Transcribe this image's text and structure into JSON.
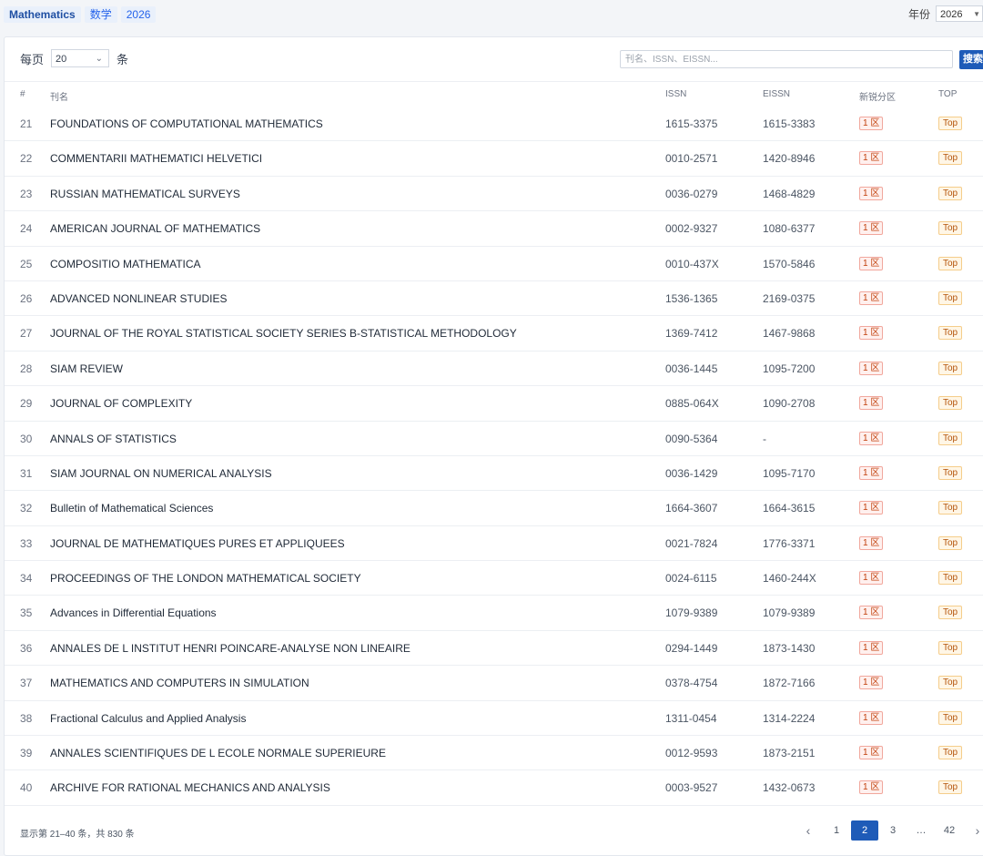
{
  "tags": [
    "Mathematics",
    "数学",
    "2026"
  ],
  "year": {
    "label": "年份",
    "value": "2026"
  },
  "controls": {
    "perpage_label": "每页",
    "perpage_value": "20",
    "perpage_unit": "条",
    "search_placeholder": "刊名、ISSN、EISSN...",
    "search_button": "搜索"
  },
  "columns": {
    "num": "#",
    "name": "刊名",
    "issn": "ISSN",
    "eissn": "EISSN",
    "zone": "新锐分区",
    "top": "TOP"
  },
  "rows": [
    {
      "num": "21",
      "name": "FOUNDATIONS OF COMPUTATIONAL MATHEMATICS",
      "issn": "1615-3375",
      "eissn": "1615-3383",
      "zone": "1 区",
      "top": "Top"
    },
    {
      "num": "22",
      "name": "COMMENTARII MATHEMATICI HELVETICI",
      "issn": "0010-2571",
      "eissn": "1420-8946",
      "zone": "1 区",
      "top": "Top"
    },
    {
      "num": "23",
      "name": "RUSSIAN MATHEMATICAL SURVEYS",
      "issn": "0036-0279",
      "eissn": "1468-4829",
      "zone": "1 区",
      "top": "Top"
    },
    {
      "num": "24",
      "name": "AMERICAN JOURNAL OF MATHEMATICS",
      "issn": "0002-9327",
      "eissn": "1080-6377",
      "zone": "1 区",
      "top": "Top"
    },
    {
      "num": "25",
      "name": "COMPOSITIO MATHEMATICA",
      "issn": "0010-437X",
      "eissn": "1570-5846",
      "zone": "1 区",
      "top": "Top"
    },
    {
      "num": "26",
      "name": "ADVANCED NONLINEAR STUDIES",
      "issn": "1536-1365",
      "eissn": "2169-0375",
      "zone": "1 区",
      "top": "Top"
    },
    {
      "num": "27",
      "name": "JOURNAL OF THE ROYAL STATISTICAL SOCIETY SERIES B-STATISTICAL METHODOLOGY",
      "issn": "1369-7412",
      "eissn": "1467-9868",
      "zone": "1 区",
      "top": "Top"
    },
    {
      "num": "28",
      "name": "SIAM REVIEW",
      "issn": "0036-1445",
      "eissn": "1095-7200",
      "zone": "1 区",
      "top": "Top"
    },
    {
      "num": "29",
      "name": "JOURNAL OF COMPLEXITY",
      "issn": "0885-064X",
      "eissn": "1090-2708",
      "zone": "1 区",
      "top": "Top"
    },
    {
      "num": "30",
      "name": "ANNALS OF STATISTICS",
      "issn": "0090-5364",
      "eissn": "-",
      "zone": "1 区",
      "top": "Top"
    },
    {
      "num": "31",
      "name": "SIAM JOURNAL ON NUMERICAL ANALYSIS",
      "issn": "0036-1429",
      "eissn": "1095-7170",
      "zone": "1 区",
      "top": "Top"
    },
    {
      "num": "32",
      "name": "Bulletin of Mathematical Sciences",
      "issn": "1664-3607",
      "eissn": "1664-3615",
      "zone": "1 区",
      "top": "Top"
    },
    {
      "num": "33",
      "name": "JOURNAL DE MATHEMATIQUES PURES ET APPLIQUEES",
      "issn": "0021-7824",
      "eissn": "1776-3371",
      "zone": "1 区",
      "top": "Top"
    },
    {
      "num": "34",
      "name": "PROCEEDINGS OF THE LONDON MATHEMATICAL SOCIETY",
      "issn": "0024-6115",
      "eissn": "1460-244X",
      "zone": "1 区",
      "top": "Top"
    },
    {
      "num": "35",
      "name": "Advances in Differential Equations",
      "issn": "1079-9389",
      "eissn": "1079-9389",
      "zone": "1 区",
      "top": "Top"
    },
    {
      "num": "36",
      "name": "ANNALES DE L INSTITUT HENRI POINCARE-ANALYSE NON LINEAIRE",
      "issn": "0294-1449",
      "eissn": "1873-1430",
      "zone": "1 区",
      "top": "Top"
    },
    {
      "num": "37",
      "name": "MATHEMATICS AND COMPUTERS IN SIMULATION",
      "issn": "0378-4754",
      "eissn": "1872-7166",
      "zone": "1 区",
      "top": "Top"
    },
    {
      "num": "38",
      "name": "Fractional Calculus and Applied Analysis",
      "issn": "1311-0454",
      "eissn": "1314-2224",
      "zone": "1 区",
      "top": "Top"
    },
    {
      "num": "39",
      "name": "ANNALES SCIENTIFIQUES DE L ECOLE NORMALE SUPERIEURE",
      "issn": "0012-9593",
      "eissn": "1873-2151",
      "zone": "1 区",
      "top": "Top"
    },
    {
      "num": "40",
      "name": "ARCHIVE FOR RATIONAL MECHANICS AND ANALYSIS",
      "issn": "0003-9527",
      "eissn": "1432-0673",
      "zone": "1 区",
      "top": "Top"
    }
  ],
  "footer": {
    "summary": "显示第 21–40 条，共 830 条",
    "pager": {
      "prev": "‹",
      "pages": [
        "1",
        "2",
        "3",
        "…",
        "42"
      ],
      "next": "›",
      "current": "2"
    }
  }
}
